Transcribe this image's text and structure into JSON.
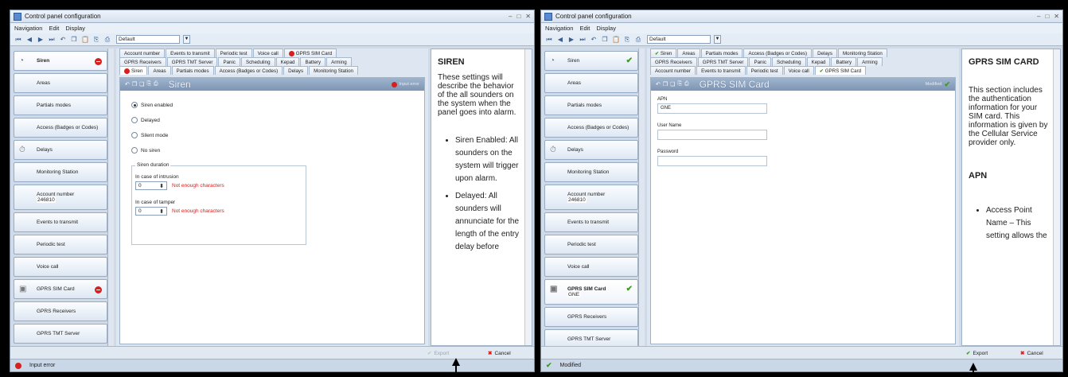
{
  "left": {
    "title": "Control panel configuration",
    "menu": [
      "Navigation",
      "Edit",
      "Display"
    ],
    "profile": "Default",
    "sidebar": [
      {
        "label": "Siren",
        "state": "error"
      },
      {
        "label": "Areas"
      },
      {
        "label": "Partials modes"
      },
      {
        "label": "Access (Badges or Codes)"
      },
      {
        "label": "Delays"
      },
      {
        "label": "Monitoring Station"
      },
      {
        "label": "Account number",
        "value": "246810"
      },
      {
        "label": "Events to transmit"
      },
      {
        "label": "Periodic test"
      },
      {
        "label": "Voice call"
      },
      {
        "label": "GPRS SIM Card",
        "state": "error"
      },
      {
        "label": "GPRS Receivers"
      },
      {
        "label": "GPRS TMT Server"
      }
    ],
    "tabs_row1": [
      "Account number",
      "Events to transmit",
      "Periodic test",
      "Voice call",
      "GPRS SIM Card"
    ],
    "tabs_row2": [
      "GPRS Receivers",
      "GPRS TMT Server",
      "Panic",
      "Scheduling",
      "Kepad",
      "Battery",
      "Arming"
    ],
    "tabs_row3": [
      "Siren",
      "Areas",
      "Partials modes",
      "Access (Badges or Codes)",
      "Delays",
      "Monitoring Station"
    ],
    "panel_title": "Siren",
    "panel_status": "Input error",
    "radios": [
      "Siren enabled",
      "Delayed",
      "Silent mode",
      "No siren"
    ],
    "duration_legend": "Siren duration",
    "intrusion_label": "In case of intrusion",
    "intrusion_value": "0",
    "tamper_label": "In case of tamper",
    "tamper_value": "0",
    "error_msg": "Not enough characters",
    "help_title": "SIREN",
    "help_text": "These settings will describe the behavior of the all sounders on the system when the panel goes into alarm.",
    "help_bullets": [
      "Siren Enabled: All sounders on the system will trigger upon alarm.",
      "Delayed: All sounders will annunciate for the length of the entry delay before"
    ],
    "export_label": "Export",
    "cancel_label": "Cancel",
    "status": "Input error"
  },
  "right": {
    "title": "Control panel configuration",
    "menu": [
      "Navigation",
      "Edit",
      "Display"
    ],
    "profile": "Default",
    "sidebar": [
      {
        "label": "Siren",
        "state": "ok"
      },
      {
        "label": "Areas"
      },
      {
        "label": "Partials modes"
      },
      {
        "label": "Access (Badges or Codes)"
      },
      {
        "label": "Delays"
      },
      {
        "label": "Monitoring Station"
      },
      {
        "label": "Account number",
        "value": "246810"
      },
      {
        "label": "Events to transmit"
      },
      {
        "label": "Periodic test"
      },
      {
        "label": "Voice call"
      },
      {
        "label": "GPRS SIM Card",
        "value": "GNE",
        "state": "ok"
      },
      {
        "label": "GPRS Receivers"
      },
      {
        "label": "GPRS TMT Server"
      }
    ],
    "tabs_row1": [
      "Siren",
      "Areas",
      "Partials modes",
      "Access (Badges or Codes)",
      "Delays",
      "Monitoring Station"
    ],
    "tabs_row2": [
      "GPRS Receivers",
      "GPRS TMT Server",
      "Panic",
      "Scheduling",
      "Kepad",
      "Battery",
      "Arming"
    ],
    "tabs_row3": [
      "Account number",
      "Events to transmit",
      "Periodic test",
      "Voice call",
      "GPRS SIM Card"
    ],
    "panel_title": "GPRS SIM Card",
    "panel_status": "Modified",
    "apn_label": "APN",
    "apn_value": "GNE",
    "user_label": "User Name",
    "user_value": "",
    "pass_label": "Password",
    "pass_value": "",
    "help_title": "GPRS SIM CARD",
    "help_text": "This section includes the authentication information for your SIM card. This information is given by the Cellular Service provider only.",
    "help_sub": "APN",
    "help_bullets": [
      "Access Point Name – This setting allows the"
    ],
    "export_label": "Export",
    "cancel_label": "Cancel",
    "status": "Modified"
  }
}
